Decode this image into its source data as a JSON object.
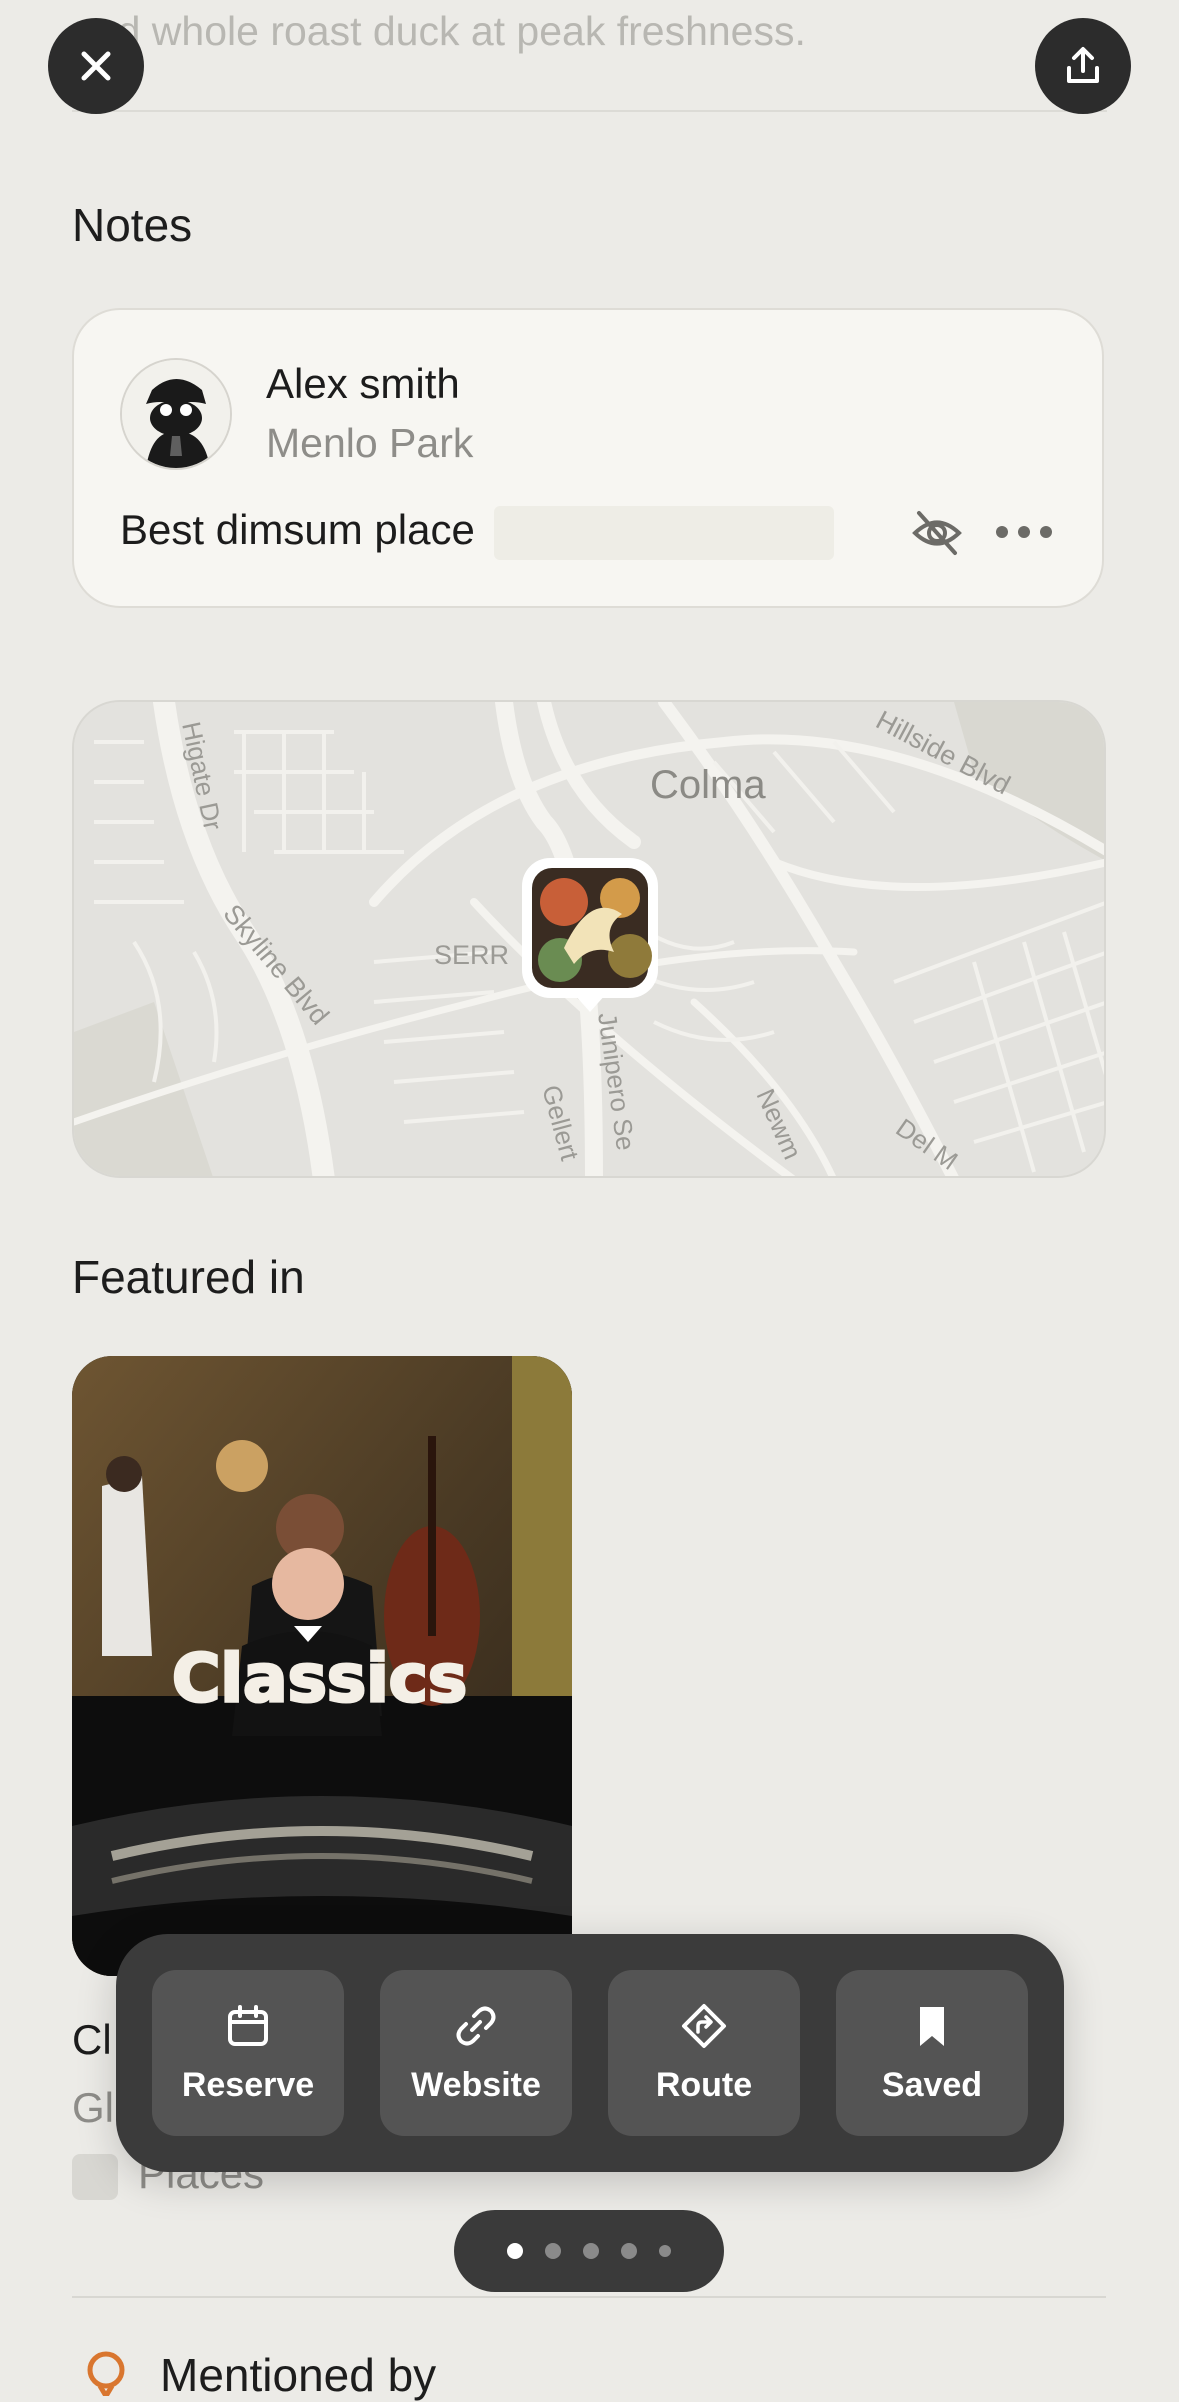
{
  "header": {
    "faded_description": "and whole roast duck at peak freshness.",
    "close_icon": "close-icon",
    "share_icon": "share-icon"
  },
  "notes": {
    "section_title": "Notes",
    "author_name": "Alex smith",
    "author_location": "Menlo Park",
    "note_text": "Best dimsum place",
    "visibility_icon": "eye-off-icon",
    "more_icon": "more-icon"
  },
  "map": {
    "labels": {
      "colma": "Colma",
      "hillside": "Hillside Blvd",
      "higate": "Higate Dr",
      "skyline": "Skyline Blvd",
      "serr": "SERR",
      "junipero": "Junipero Se",
      "gellert": "Gellert",
      "newm": "Newm",
      "delm": "Del M"
    }
  },
  "featured": {
    "section_title": "Featured in",
    "card_title_art": "Classics",
    "list_title_fragment": "Cl",
    "list_sub_fragment": "Gl",
    "list_tag": "Places"
  },
  "actions": [
    {
      "label": "Reserve",
      "icon": "calendar-icon"
    },
    {
      "label": "Website",
      "icon": "link-icon"
    },
    {
      "label": "Route",
      "icon": "directions-icon"
    },
    {
      "label": "Saved",
      "icon": "bookmark-icon"
    }
  ],
  "pager": {
    "count": 5,
    "active_index": 0
  },
  "mentioned": {
    "title": "Mentioned by",
    "icon": "location-pin-icon"
  },
  "colors": {
    "background": "#ecebe7",
    "dark_button": "#2c2c2c",
    "action_bar": "#3b3b3b",
    "action_button": "#545454",
    "accent_orange": "#d9762f"
  }
}
